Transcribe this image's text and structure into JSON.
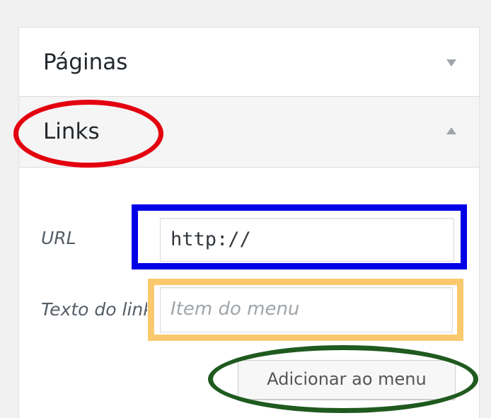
{
  "menu_panel": {
    "sections": [
      {
        "title": "Páginas",
        "expanded": false,
        "toggle_icon": "triangle-down-icon"
      },
      {
        "title": "Links",
        "expanded": true,
        "toggle_icon": "triangle-up-icon"
      }
    ],
    "links_form": {
      "url_label": "URL",
      "url_value": "http://",
      "link_text_label": "Texto do link",
      "link_text_placeholder": "Item do menu",
      "add_button_label": "Adicionar ao menu"
    }
  },
  "annotations": {
    "red_ellipse_color": "#e3000f",
    "blue_box_color": "#0000e6",
    "orange_box_color": "#fbc96d",
    "green_ellipse_color": "#1f5a1f"
  }
}
